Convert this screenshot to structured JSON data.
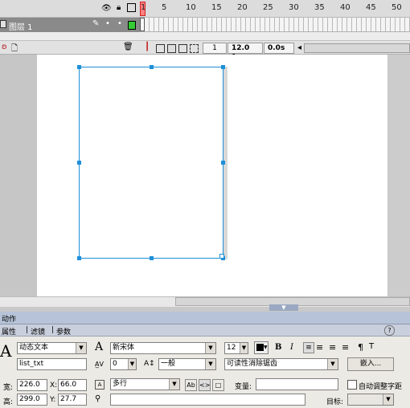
{
  "timeline": {
    "header_icons": [
      "eye-icon",
      "lock-icon",
      "outline-icon"
    ],
    "frame_numbers": [
      "1",
      "5",
      "10",
      "15",
      "20",
      "25",
      "30",
      "35",
      "40",
      "45",
      "50"
    ],
    "layer": {
      "name": "图层 1",
      "icon": "layer-icon",
      "color": "#33cc33"
    },
    "footer": {
      "current_frame": "1",
      "frame_rate": "12.0 fps",
      "elapsed": "0.0s"
    }
  },
  "panels": {
    "actions_title": "动作",
    "tabs": [
      "属性",
      "滤镜",
      "参数"
    ],
    "properties": {
      "text_type": "动态文本",
      "instance_name": "list_txt",
      "font_name": "新宋体",
      "font_size": "12",
      "letter_spacing": "0",
      "char_position": "一般",
      "anti_alias": "可读性消除锯齿",
      "embed_button": "嵌入...",
      "line_type": "多行",
      "var_label": "变量:",
      "auto_kern_label": "自动调整字距",
      "target_label": "目标:",
      "width_label": "宽:",
      "width": "226.0",
      "x_label": "X:",
      "x": "66.0",
      "height_label": "高:",
      "height": "299.0",
      "y_label": "Y:",
      "y": "27.7"
    }
  },
  "colors": {
    "selection": "#1e8fd8",
    "playhead": "#ff6666"
  }
}
